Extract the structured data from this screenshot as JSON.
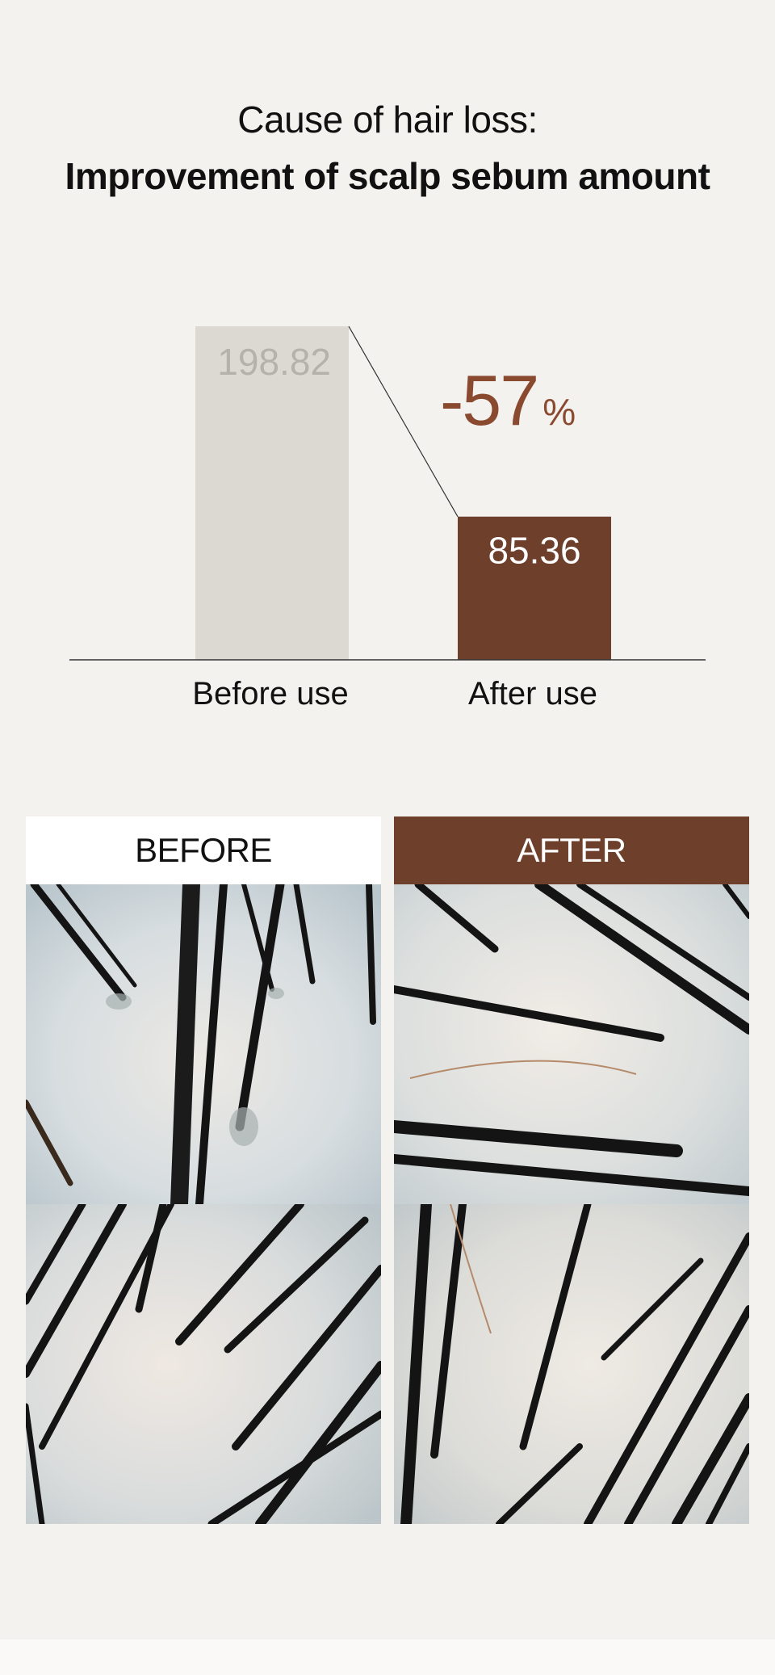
{
  "title": {
    "line1": "Cause of hair loss:",
    "line2": "Improvement of scalp sebum amount"
  },
  "chart_data": {
    "type": "bar",
    "categories": [
      "Before use",
      "After use"
    ],
    "values": [
      198.82,
      85.36
    ],
    "value_labels": [
      "198.82",
      "85.36"
    ],
    "change_label": {
      "number": "-57",
      "unit": "%"
    },
    "colors": {
      "before": "#dcd8d2",
      "after": "#6e3f2b",
      "before_label": "#b6b1ab",
      "change": "#8a4a30"
    }
  },
  "photos": {
    "before_label": "BEFORE",
    "after_label": "AFTER"
  }
}
